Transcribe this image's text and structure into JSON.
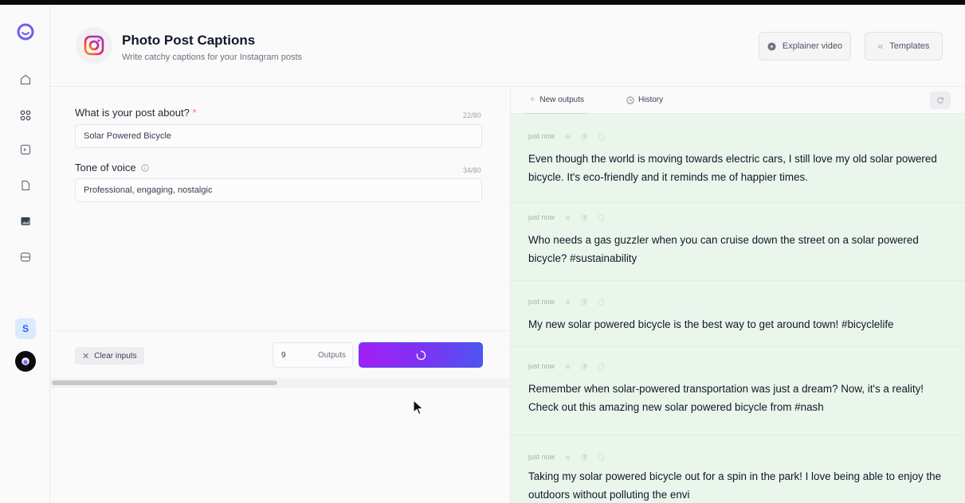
{
  "app": {
    "title": "Photo Post Captions",
    "subtitle": "Write catchy captions for your Instagram posts",
    "icon": "instagram-icon"
  },
  "header": {
    "explainer_label": "Explainer video",
    "templates_label": "Templates"
  },
  "sidebar": {
    "items": [
      "home-icon",
      "grid-icon",
      "terminal-icon",
      "document-icon",
      "image-icon",
      "inbox-icon"
    ],
    "user_initial": "S"
  },
  "form": {
    "field1": {
      "label": "What is your post about?",
      "required_mark": "*",
      "counter": "22/80",
      "value": "Solar Powered Bicycle"
    },
    "field2": {
      "label": "Tone of voice",
      "counter": "34/80",
      "value": "Professional, engaging, nostalgic"
    },
    "clear_label": "Clear inputs",
    "outputs_count": "9",
    "outputs_label": "Outputs"
  },
  "output_panel": {
    "tabs": {
      "new_outputs": "New outputs",
      "history": "History"
    },
    "items": [
      {
        "time": "just now",
        "text": "Even though the world is moving towards electric cars, I still love my old solar powered bicycle. It's eco-friendly and it reminds me of happier times."
      },
      {
        "time": "just now",
        "text": "Who needs a gas guzzler when you can cruise down the street on a solar powered bicycle? #sustainability"
      },
      {
        "time": "just now",
        "text": "My new solar powered bicycle is the best way to get around town! #bicyclelife"
      },
      {
        "time": "just now",
        "text": "Remember when solar-powered transportation was just a dream? Now, it's a reality! Check out this amazing new solar powered bicycle from #nash"
      },
      {
        "time": "just now",
        "text": "Taking my solar powered bicycle out for a spin in the park! I love being able to enjoy the outdoors without polluting the envi"
      }
    ]
  },
  "colors": {
    "accent_gradient_start": "#a41ff5",
    "accent_gradient_end": "#4e55f0",
    "output_background": "#eaf6ec",
    "user_avatar": "#dbeafe"
  }
}
